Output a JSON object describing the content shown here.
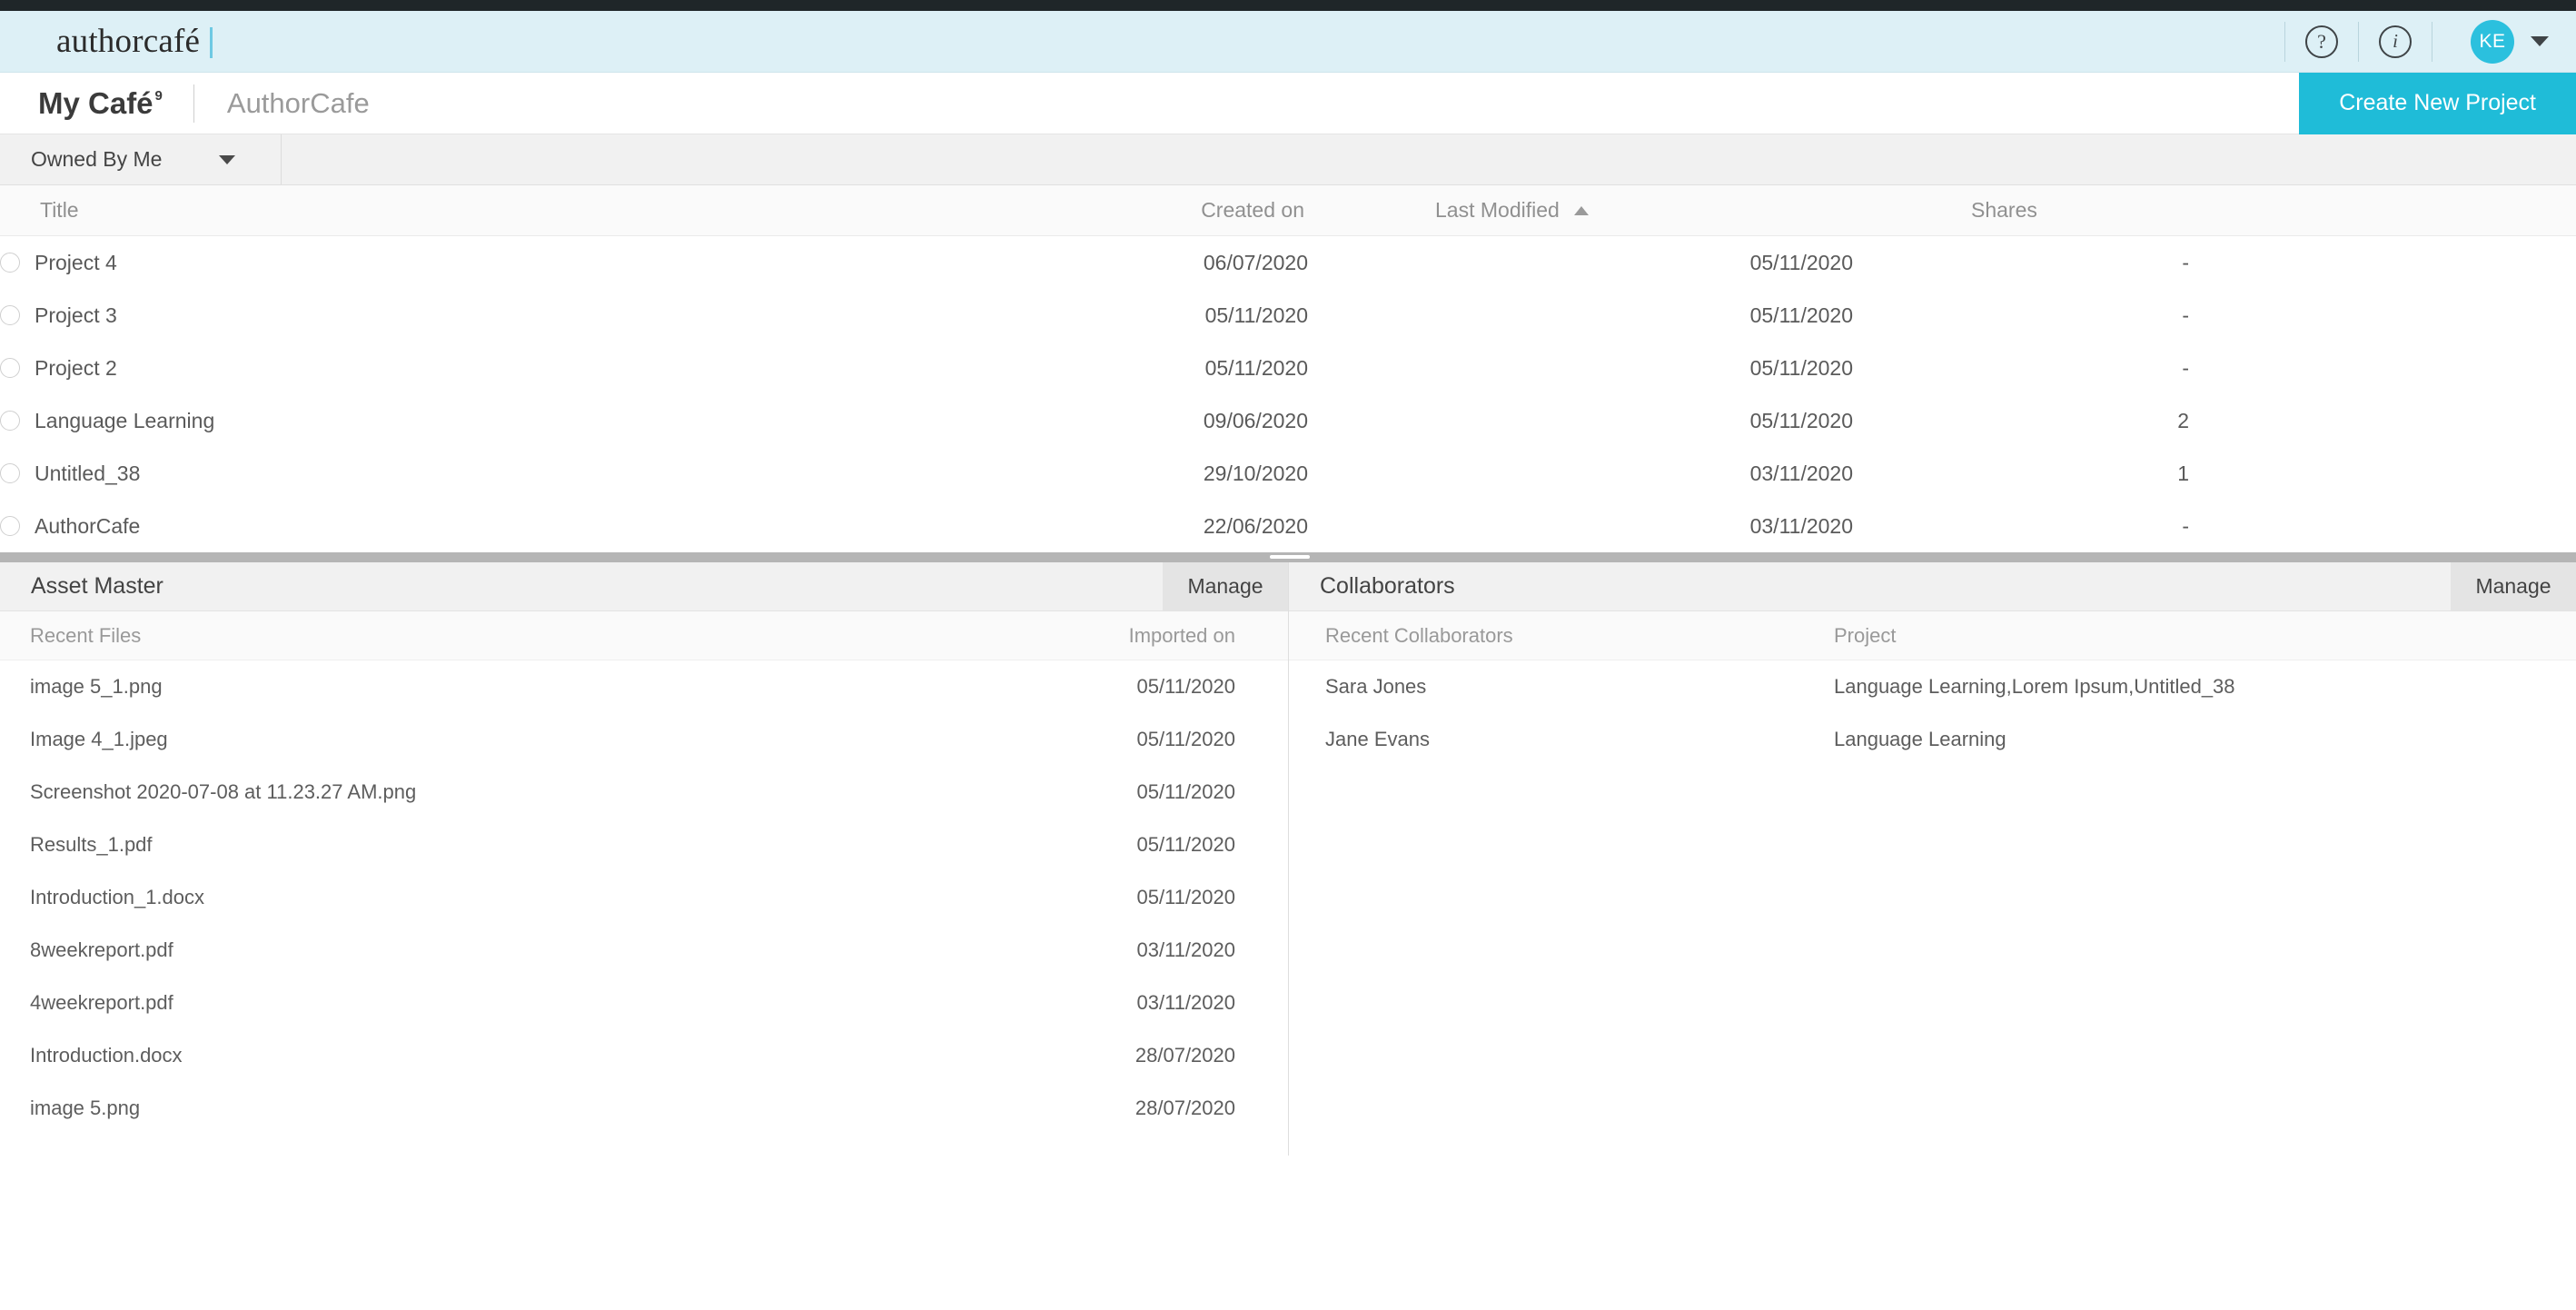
{
  "brand": {
    "logo": "authorcafé",
    "help_icon": "?",
    "info_icon": "i",
    "avatar_initials": "KE"
  },
  "titlebar": {
    "workspace": "My Café",
    "workspace_badge": "9",
    "project": "AuthorCafe",
    "create_button": "Create New Project"
  },
  "filter": {
    "selected": "Owned By Me"
  },
  "projects": {
    "columns": {
      "title": "Title",
      "created": "Created on",
      "modified": "Last Modified",
      "shares": "Shares"
    },
    "sort": {
      "column": "Last Modified",
      "direction": "asc"
    },
    "rows": [
      {
        "title": "Project 4",
        "created": "06/07/2020",
        "modified": "05/11/2020",
        "shares": "-"
      },
      {
        "title": "Project 3",
        "created": "05/11/2020",
        "modified": "05/11/2020",
        "shares": "-"
      },
      {
        "title": "Project 2",
        "created": "05/11/2020",
        "modified": "05/11/2020",
        "shares": "-"
      },
      {
        "title": "Language Learning",
        "created": "09/06/2020",
        "modified": "05/11/2020",
        "shares": "2"
      },
      {
        "title": "Untitled_38",
        "created": "29/10/2020",
        "modified": "03/11/2020",
        "shares": "1"
      },
      {
        "title": "AuthorCafe",
        "created": "22/06/2020",
        "modified": "03/11/2020",
        "shares": "-"
      }
    ]
  },
  "asset_master": {
    "title": "Asset Master",
    "manage": "Manage",
    "columns": {
      "name": "Recent Files",
      "date": "Imported on"
    },
    "rows": [
      {
        "name": "image 5_1.png",
        "date": "05/11/2020"
      },
      {
        "name": "Image 4_1.jpeg",
        "date": "05/11/2020"
      },
      {
        "name": "Screenshot 2020-07-08 at 11.23.27 AM.png",
        "date": "05/11/2020"
      },
      {
        "name": "Results_1.pdf",
        "date": "05/11/2020"
      },
      {
        "name": "Introduction_1.docx",
        "date": "05/11/2020"
      },
      {
        "name": "8weekreport.pdf",
        "date": "03/11/2020"
      },
      {
        "name": "4weekreport.pdf",
        "date": "03/11/2020"
      },
      {
        "name": "Introduction.docx",
        "date": "28/07/2020"
      },
      {
        "name": "image 5.png",
        "date": "28/07/2020"
      }
    ]
  },
  "collaborators": {
    "title": "Collaborators",
    "manage": "Manage",
    "columns": {
      "name": "Recent Collaborators",
      "project": "Project"
    },
    "rows": [
      {
        "name": "Sara Jones",
        "project": "Language Learning,Lorem Ipsum,Untitled_38"
      },
      {
        "name": "Jane Evans",
        "project": "Language Learning"
      }
    ]
  },
  "colors": {
    "accent": "#1fbcd8",
    "brand_bar": "#ddf0f6",
    "top_strip": "#1f2629",
    "avatar": "#2bc0de"
  }
}
